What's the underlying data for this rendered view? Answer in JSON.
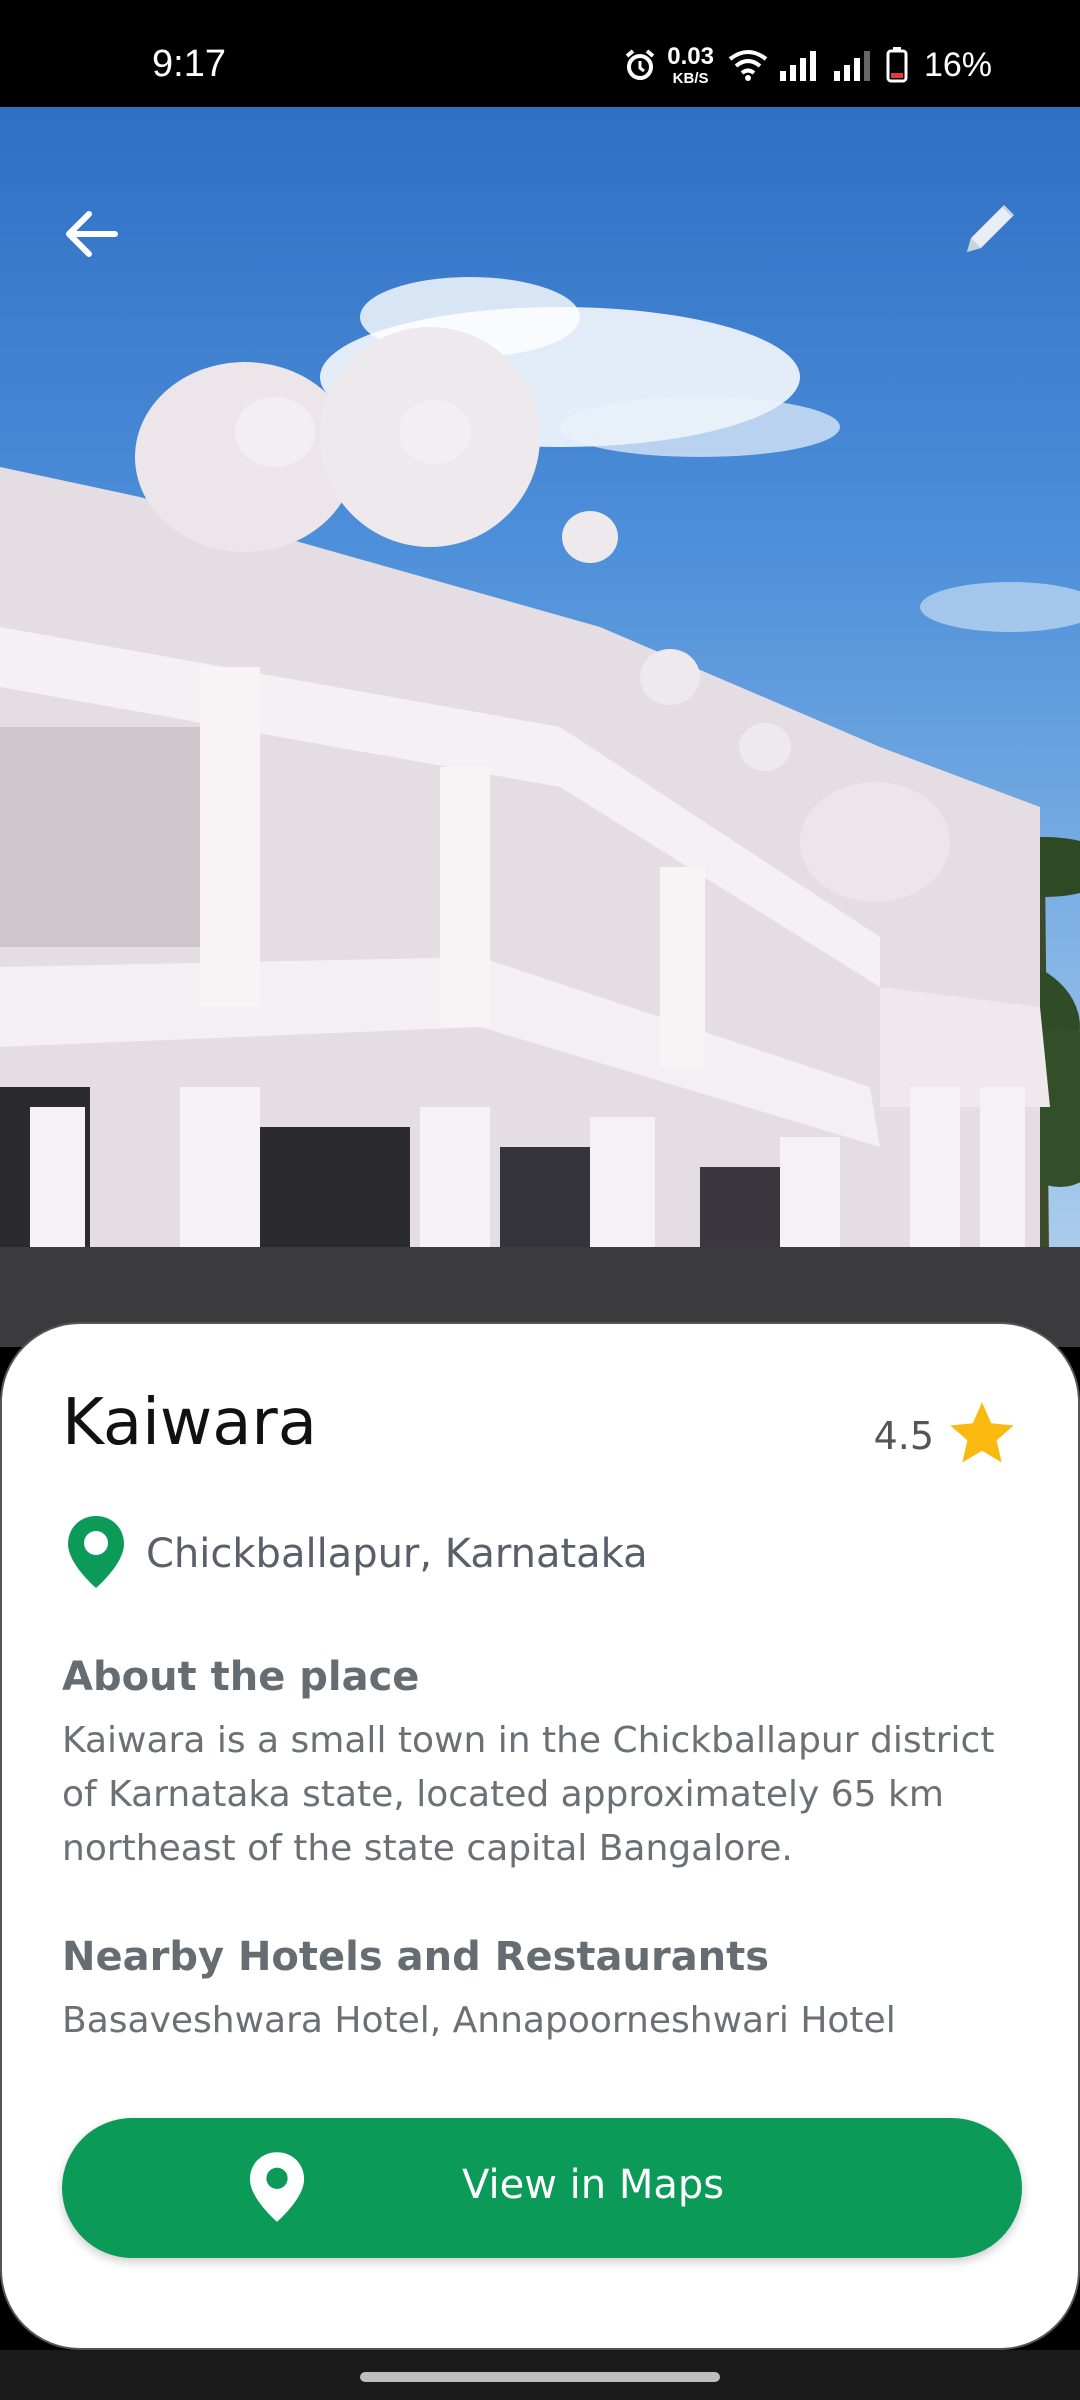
{
  "status_bar": {
    "time": "9:17",
    "net_speed_value": "0.03",
    "net_speed_unit": "KB/S",
    "battery_percent": "16%",
    "icons": [
      "alarm-icon",
      "wifi-icon",
      "signal-icon",
      "signal-icon",
      "battery-low-icon"
    ]
  },
  "header": {
    "back_icon": "arrow-left-icon",
    "edit_icon": "pencil-icon"
  },
  "place": {
    "name": "Kaiwara",
    "rating": "4.5",
    "location": "Chickballapur, Karnataka"
  },
  "about": {
    "heading": "About the place",
    "body": "Kaiwara is a small town in the Chickballapur district of Karnataka state, located approximately 65 km northeast of the state capital Bangalore."
  },
  "nearby": {
    "heading": "Nearby Hotels and Restaurants",
    "body": "Basaveshwara Hotel, Annapoorneshwari Hotel"
  },
  "actions": {
    "maps_label": "View in Maps"
  },
  "colors": {
    "accent": "#0C9A58",
    "star": "#F9B90F",
    "sky": "#3E7FCF"
  }
}
